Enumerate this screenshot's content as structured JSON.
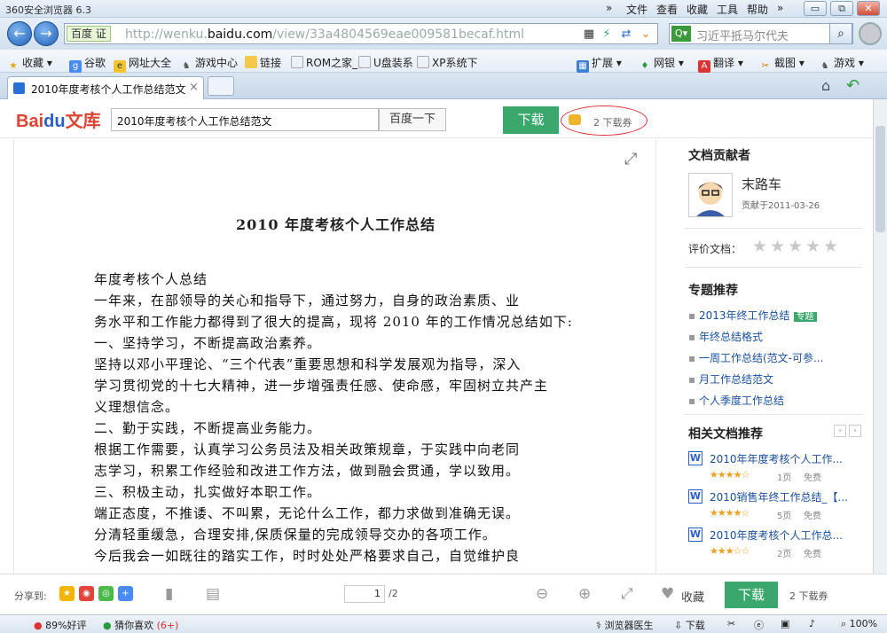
{
  "app": {
    "title": "360安全浏览器 6.3"
  },
  "menu": [
    "文件",
    "查看",
    "收藏",
    "工具",
    "帮助"
  ],
  "window_controls": {
    "more": "»",
    "minimize": "▭",
    "restore": "⧉",
    "close": "✕"
  },
  "address": {
    "badge": "百度 证",
    "url_prefix": "http://wenku.",
    "url_domain": "baidu.com",
    "url_suffix": "/view/33a4804569eae009581becaf.html"
  },
  "search": {
    "text": "习近平抵马尔代夫"
  },
  "favorites": [
    "收藏",
    "谷歌",
    "网址大全",
    "游戏中心",
    "链接",
    "ROM之家_",
    "U盘装系",
    "XP系统下",
    "扩展",
    "网银",
    "翻译",
    "截图",
    "游戏"
  ],
  "tab": {
    "label": "2010年度考核个人工作总结范文",
    "close": "×"
  },
  "baidu": {
    "query": "2010年度考核个人工作总结范文",
    "search_button": "百度一下",
    "download_button": "下载",
    "ticket_text": "2 下载券"
  },
  "document": {
    "title": "2010 年度考核个人工作总结",
    "lines": [
      "年度考核个人总结",
      "    一年来，在部领导的关心和指导下，通过努力，自身的政治素质、业",
      "务水平和工作能力都得到了很大的提高，现将 2010 年的工作情况总结如下:",
      "    一、坚持学习，不断提高政治素养。",
      "    坚持以邓小平理论、“三个代表”重要思想和科学发展观为指导，深入",
      "学习贯彻党的十七大精神，进一步增强责任感、使命感，牢固树立共产主",
      "义理想信念。",
      "    二、勤于实践，不断提高业务能力。",
      "    根据工作需要，认真学习公务员法及相关政策规章，于实践中向老同",
      "志学习，积累工作经验和改进工作方法，做到融会贯通，学以致用。",
      "    三、积极主动，扎实做好本职工作。",
      "    端正态度，不推诿、不叫累，无论什么工作，都力求做到准确无误。",
      "分清轻重缓急，合理安排,保质保量的完成领导交办的各项工作。",
      "    今后我会一如既往的踏实工作，时时处处严格要求自己，自觉维护良"
    ]
  },
  "sidebar": {
    "contributor_heading": "文档贡献者",
    "contributor_name": "末路车",
    "contributor_date": "贡献于2011-03-26",
    "rate_label": "评价文档：",
    "topics_heading": "专题推荐",
    "topics": [
      "2013年终工作总结",
      "年终总结格式",
      "一周工作总结(范文-可参...",
      "月工作总结范文",
      "个人季度工作总结"
    ],
    "topic_badge": "专题",
    "related_heading": "相关文档推荐",
    "related": [
      {
        "title": "2010年年度考核个人工作...",
        "stars": "★★★★☆",
        "pages": "1页",
        "price": "免费"
      },
      {
        "title": "2010销售年终工作总结_【...",
        "stars": "★★★★☆",
        "pages": "5页",
        "price": "免费"
      },
      {
        "title": "2010年度考核个人工作总...",
        "stars": "★★★☆☆",
        "pages": "2页",
        "price": "免费"
      }
    ]
  },
  "bottom": {
    "share_label": "分享到:",
    "page_current": "1",
    "page_total": "/2",
    "collect": "收藏",
    "download": "下载",
    "ticket": "2 下载券"
  },
  "status": {
    "rating": "89%好评",
    "guess": "猜你喜欢",
    "guess_count": "(6+)",
    "doctor": "浏览器医生",
    "download": "下载",
    "zoom": "100%"
  }
}
